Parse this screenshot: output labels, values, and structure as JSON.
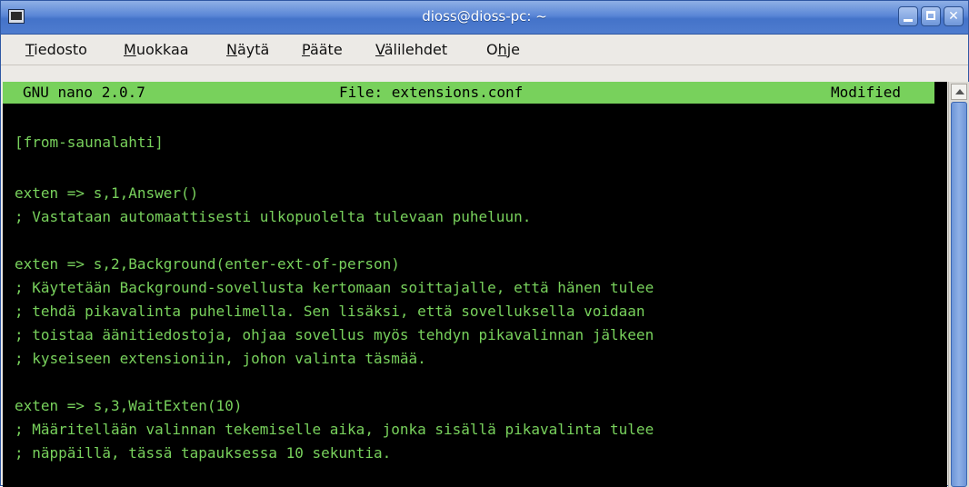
{
  "window": {
    "title": "dioss@dioss-pc: ~"
  },
  "menu": [
    {
      "pre": "",
      "u": "T",
      "post": "iedosto"
    },
    {
      "pre": "",
      "u": "M",
      "post": "uokkaa"
    },
    {
      "pre": "",
      "u": "N",
      "post": "äytä"
    },
    {
      "pre": "",
      "u": "P",
      "post": "ääte"
    },
    {
      "pre": "",
      "u": "V",
      "post": "älilehdet"
    },
    {
      "pre": "O",
      "u": "h",
      "post": "je"
    }
  ],
  "nano": {
    "version": "GNU nano 2.0.7",
    "file": "File: extensions.conf",
    "status": "Modified"
  },
  "lines": [
    "[from-saunalahti]",
    "exten => s,1,Answer()",
    "; Vastataan automaattisesti ulkopuolelta tulevaan puheluun.",
    "exten => s,2,Background(enter-ext-of-person)",
    "; Käytetään Background-sovellusta kertomaan soittajalle, että hänen tulee",
    "; tehdä pikavalinta puhelimella. Sen lisäksi, että sovelluksella voidaan",
    "; toistaa äänitiedostoja, ohjaa sovellus myös tehdyn pikavalinnan jälkeen",
    "; kyseiseen extensioniin, johon valinta täsmää.",
    "exten => s,3,WaitExten(10)",
    "; Määritellään valinnan tekemiselle aika, jonka sisällä pikavalinta tulee",
    "; näppäillä, tässä tapauksessa 10 sekuntia."
  ]
}
